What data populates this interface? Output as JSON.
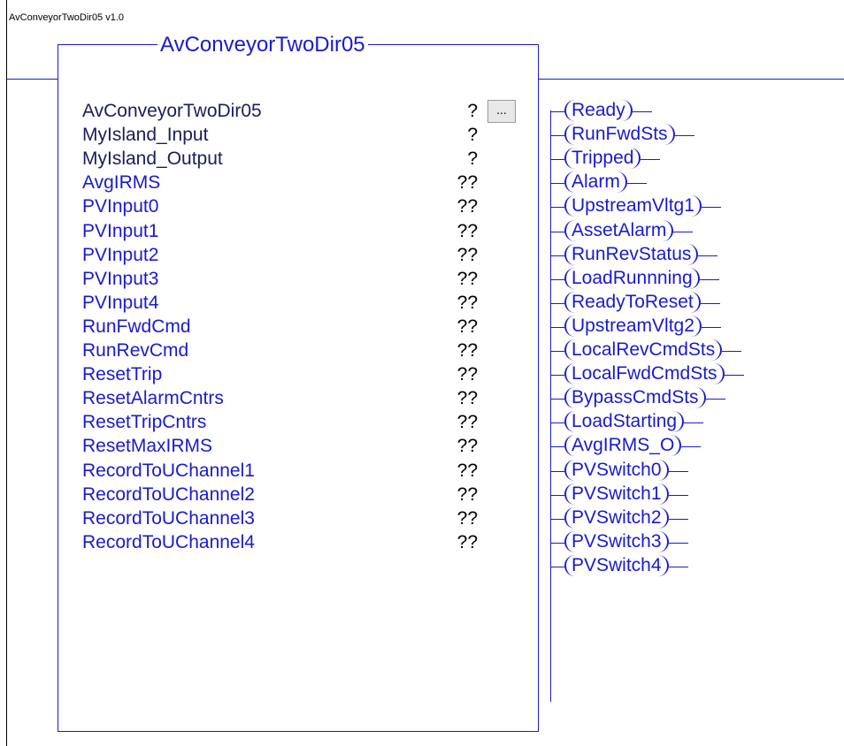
{
  "window_title": "AvConveyorTwoDir05 v1.0",
  "block_title": "AvConveyorTwoDir05",
  "ellipsis_label": "...",
  "inputs": [
    {
      "name": "AvConveyorTwoDir05",
      "value": "?"
    },
    {
      "name": "MyIsland_Input",
      "value": "?"
    },
    {
      "name": "MyIsland_Output",
      "value": "?"
    },
    {
      "name": "AvgIRMS",
      "value": "??"
    },
    {
      "name": "PVInput0",
      "value": "??"
    },
    {
      "name": "PVInput1",
      "value": "??"
    },
    {
      "name": "PVInput2",
      "value": "??"
    },
    {
      "name": "PVInput3",
      "value": "??"
    },
    {
      "name": "PVInput4",
      "value": "??"
    },
    {
      "name": "RunFwdCmd",
      "value": "??"
    },
    {
      "name": "RunRevCmd",
      "value": "??"
    },
    {
      "name": "ResetTrip",
      "value": "??"
    },
    {
      "name": "ResetAlarmCntrs",
      "value": "??"
    },
    {
      "name": "ResetTripCntrs",
      "value": "??"
    },
    {
      "name": "ResetMaxIRMS",
      "value": "??"
    },
    {
      "name": "RecordToUChannel1",
      "value": "??"
    },
    {
      "name": "RecordToUChannel2",
      "value": "??"
    },
    {
      "name": "RecordToUChannel3",
      "value": "??"
    },
    {
      "name": "RecordToUChannel4",
      "value": "??"
    }
  ],
  "outputs": [
    "Ready",
    "RunFwdSts",
    "Tripped",
    "Alarm",
    "UpstreamVltg1",
    "AssetAlarm",
    "RunRevStatus",
    "LoadRunnning",
    "ReadyToReset",
    "UpstreamVltg2",
    "LocalRevCmdSts",
    "LocalFwdCmdSts",
    "BypassCmdSts",
    "LoadStarting",
    "AvgIRMS_O",
    "PVSwitch0",
    "PVSwitch1",
    "PVSwitch2",
    "PVSwitch3",
    "PVSwitch4"
  ],
  "colors": {
    "wire": "#1a1acd",
    "config_params": "#1c1c5a",
    "values": "#000000"
  }
}
